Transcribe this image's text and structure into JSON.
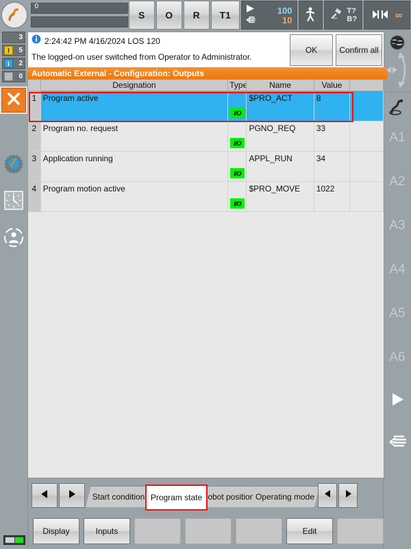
{
  "topbar": {
    "logo_icon": "kuka-robot-logo-icon",
    "slider_value": "0",
    "status_buttons": [
      {
        "label": "S",
        "name": "status-submit-interpreter"
      },
      {
        "label": "O",
        "name": "status-drives"
      },
      {
        "label": "R",
        "name": "status-robot-interpreter"
      },
      {
        "label": "T1",
        "name": "status-operating-mode"
      }
    ],
    "override": {
      "program_icon": "play-triangle-icon",
      "program_value": "100",
      "manual_icon": "hand-jog-icon",
      "manual_value": "10"
    },
    "jog_mode_icon": "walking-person-icon",
    "tool_base": {
      "icon": "welding-torch-icon",
      "tool_label": "T?",
      "base_label": "B?"
    },
    "increment_icon": "increment-jog-icon",
    "increment_value": "∞"
  },
  "left_sidebar": {
    "badges": [
      {
        "icon": "none",
        "count": "3",
        "name": "message-badge-total"
      },
      {
        "icon": "warning",
        "count": "5",
        "name": "message-badge-warning"
      },
      {
        "icon": "info",
        "count": "2",
        "name": "message-badge-info"
      },
      {
        "icon": "gray",
        "count": "0",
        "name": "message-badge-acknowledged"
      }
    ],
    "stop_button_icon": "close-x-icon",
    "buttons": [
      {
        "icon": "robot-settings-gear-icon",
        "name": "sidebar-robot-settings"
      },
      {
        "icon": "clock-icon",
        "name": "sidebar-clock"
      },
      {
        "icon": "user-group-icon",
        "name": "sidebar-user"
      }
    ],
    "status_led": "green"
  },
  "right_sidebar": {
    "globe_icon": "world-coordinates-globe-icon",
    "jog_arrows_icon": "jog-direction-arrows-icon",
    "robot_icon": "robot-axis-icon",
    "axes": [
      "A1",
      "A2",
      "A3",
      "A4",
      "A5",
      "A6"
    ],
    "play_icon": "play-triangle-icon",
    "hand_icon": "hand-jog-icon"
  },
  "message": {
    "info_icon": "info-circle-icon",
    "timestamp": "2:24:42 PM 4/16/2024 LOS 120",
    "text": "The logged-on user switched from Operator to Administrator.",
    "ok_label": "OK",
    "confirm_all_label": "Confirm all"
  },
  "title": "Automatic External - Configuration: Outputs",
  "table": {
    "headers": [
      "",
      "Designation",
      "Type",
      "Name",
      "Value",
      ""
    ],
    "rows": [
      {
        "num": "1",
        "designation": "Program active",
        "type_icon": "io-signal-icon",
        "type_label": "I/O",
        "name": "$PRO_ACT",
        "value": "8",
        "selected": true
      },
      {
        "num": "2",
        "designation": "Program no. request",
        "type_icon": "io-signal-icon",
        "type_label": "I/O",
        "name": "PGNO_REQ",
        "value": "33",
        "selected": false
      },
      {
        "num": "3",
        "designation": "Application running",
        "type_icon": "io-signal-icon",
        "type_label": "I/O",
        "name": "APPL_RUN",
        "value": "34",
        "selected": false
      },
      {
        "num": "4",
        "designation": "Program motion active",
        "type_icon": "io-signal-icon",
        "type_label": "I/O",
        "name": "$PRO_MOVE",
        "value": "1022",
        "selected": false
      }
    ]
  },
  "tabbar": {
    "prev_icon": "arrow-left-icon",
    "next_icon": "arrow-right-icon",
    "tabs": [
      {
        "label": "Start conditions",
        "active": false
      },
      {
        "label": "Program state",
        "active": true
      },
      {
        "label": "Robot position",
        "active": false
      },
      {
        "label": "Operating mode",
        "active": false
      }
    ],
    "scroll_prev_icon": "arrow-left-icon",
    "scroll_next_icon": "arrow-right-icon"
  },
  "function_keys": [
    {
      "label": "Display",
      "empty": false
    },
    {
      "label": "Inputs",
      "empty": false
    },
    {
      "label": "",
      "empty": true
    },
    {
      "label": "",
      "empty": true
    },
    {
      "label": "",
      "empty": true
    },
    {
      "label": "Edit",
      "empty": false
    },
    {
      "label": "",
      "empty": true
    }
  ],
  "colors": {
    "accent_orange": "#ee7a12",
    "selection_blue": "#2fb2ef",
    "highlight_red": "#ee1111",
    "io_green": "#00ef00",
    "chrome_gray": "#9aa3a8"
  }
}
